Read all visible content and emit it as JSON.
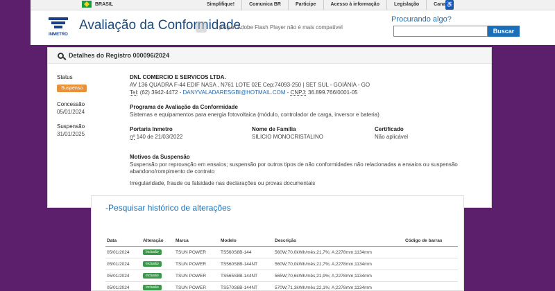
{
  "gov": {
    "country": "BRASIL",
    "links": [
      "Simplifique!",
      "Comunica BR",
      "Participe",
      "Acesso à informação",
      "Legislação",
      "Canais"
    ]
  },
  "header": {
    "logo_text": "INMETRO",
    "title": "Avaliação da Conformidade",
    "flash_note": "plug-in Adobe Flash Player não é mais compatível",
    "search_label": "Procurando algo?",
    "search_value": "",
    "search_button": "Buscar"
  },
  "record": {
    "title": "Detalhes do Registro 000096/2024",
    "status_label": "Status",
    "status_value": "Suspenso",
    "concession_label": "Concessão",
    "concession_date": "05/01/2024",
    "suspension_label": "Suspensão",
    "suspension_date": "31/01/2025",
    "company": "DNL COMERCIO E SERVICOS LTDA.",
    "address": "AV 136 QUADRA F-44 EDIF NASA , N761 LOTE 02E Cep:74093-250 | SET SUL - GOIÂNIA - GO",
    "tel_label": "Tel:",
    "tel_value": "(62) 3942-4472",
    "email": "DANYVALADARESGBI@HOTMAIL.COM",
    "cnpj_label": "CNPJ:",
    "cnpj_value": "36.899.766/0001-05",
    "program_label": "Programa de Avaliação da Conformidade",
    "program_value": "Sistemas e equipamentos para energia fotovoltaica (módulo, controlador de carga, inversor e bateria)",
    "portaria_label": "Portaria Inmetro",
    "portaria_no": "nº",
    "portaria_value": "140 de 21/03/2022",
    "family_label": "Nome de Família",
    "family_value": "SILICIO MONOCRISTALINO",
    "cert_label": "Certificado",
    "cert_value": "Não aplicável",
    "reasons_label": "Motivos da Suspensão",
    "reason_1": "Suspensão por reprovação em ensaios; suspensão por outros tipos de não conformidades não relacionadas a ensaios ou suspensão abandono/rompimento de contrato",
    "reason_2": "Irregularidade, fraude ou falsidade nas declarações ou provas documentais"
  },
  "history": {
    "title": "-Pesquisar histórico de alterações",
    "columns": [
      "Data",
      "Alteração",
      "Marca",
      "Modelo",
      "Descrição",
      "Código de barras"
    ],
    "rows": [
      [
        "05/01/2024",
        "Inclusão",
        "TSUN POWER",
        "TS560S8B-144",
        "560W;70,0kWh/mês;21,7%; A;2278mm;1134mm",
        ""
      ],
      [
        "05/01/2024",
        "Inclusão",
        "TSUN POWER",
        "TS560S8B-144NT",
        "560W;70,0kWh/mês;21,7%; A;2278mm;1134mm",
        ""
      ],
      [
        "05/01/2024",
        "Inclusão",
        "TSUN POWER",
        "TS565S8B-144NT",
        "565W;70,6kWh/mês;21,9%; A;2278mm;1134mm",
        ""
      ],
      [
        "05/01/2024",
        "Inclusão",
        "TSUN POWER",
        "TS570S8B-144NT",
        "570W;71,3kWh/mês;22,1%; A;2278mm;1134mm",
        ""
      ]
    ]
  }
}
